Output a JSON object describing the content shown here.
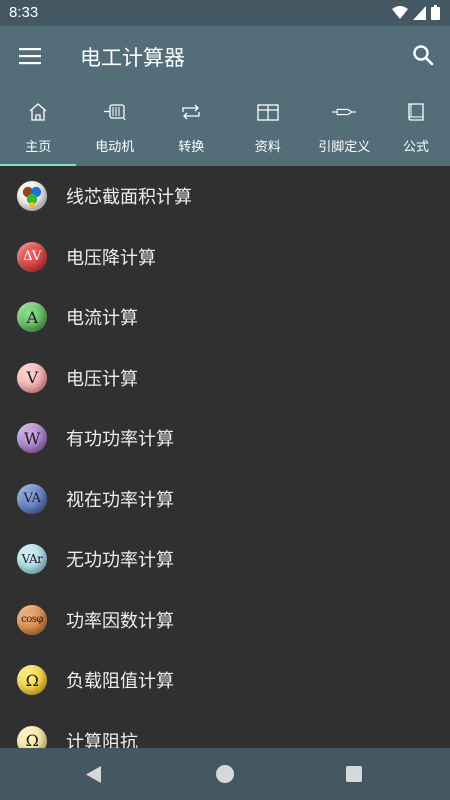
{
  "status": {
    "time": "8:33"
  },
  "app_bar": {
    "title": "电工计算器"
  },
  "tabs": [
    {
      "label": "主页",
      "icon": "home-icon",
      "selected": true
    },
    {
      "label": "电动机",
      "icon": "motor-icon"
    },
    {
      "label": "转换",
      "icon": "convert-icon"
    },
    {
      "label": "资料",
      "icon": "table-icon"
    },
    {
      "label": "引脚定义",
      "icon": "connector-icon"
    },
    {
      "label": "公式",
      "icon": "book-icon"
    }
  ],
  "colors": {
    "accent": "#7fe0c7",
    "app_bar": "#536e79",
    "status_bar": "#435862",
    "background": "#303030"
  },
  "items": [
    {
      "label": "线芯截面积计算",
      "icon": "wire-cores-icon",
      "icon_text": ""
    },
    {
      "label": "电压降计算",
      "icon": "voltage-drop-icon",
      "icon_text": "ΔV"
    },
    {
      "label": "电流计算",
      "icon": "current-icon",
      "icon_text": "A"
    },
    {
      "label": "电压计算",
      "icon": "voltage-icon",
      "icon_text": "V"
    },
    {
      "label": "有功功率计算",
      "icon": "active-power-icon",
      "icon_text": "W"
    },
    {
      "label": "视在功率计算",
      "icon": "apparent-power-icon",
      "icon_text": "VA"
    },
    {
      "label": "无功功率计算",
      "icon": "reactive-power-icon",
      "icon_text": "VAr"
    },
    {
      "label": "功率因数计算",
      "icon": "power-factor-icon",
      "icon_text": "cosφ"
    },
    {
      "label": "负载阻值计算",
      "icon": "load-resistance-icon",
      "icon_text": "Ω"
    },
    {
      "label": "计算阻抗",
      "icon": "impedance-icon",
      "icon_text": "Ω"
    }
  ]
}
